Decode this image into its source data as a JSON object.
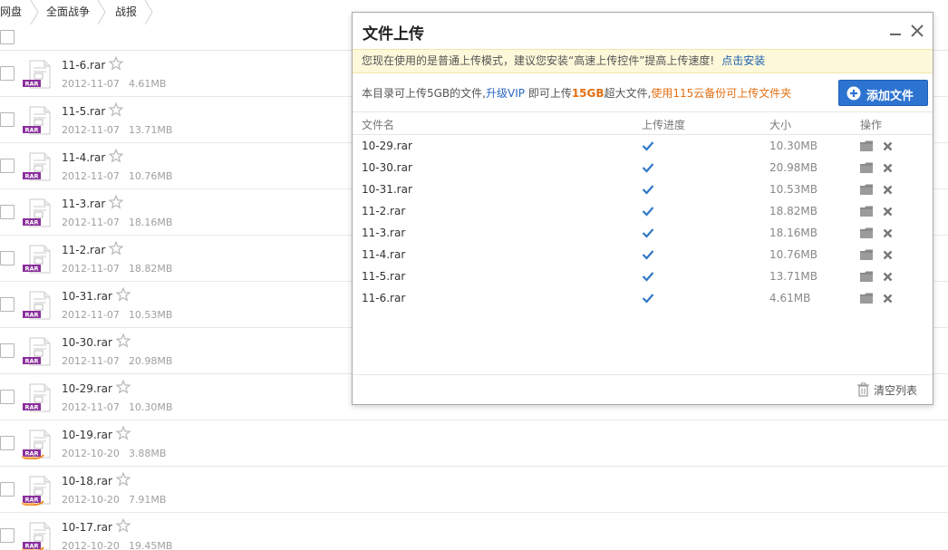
{
  "breadcrumb": {
    "items": [
      "网盘",
      "全面战争",
      "战报"
    ]
  },
  "files": [
    {
      "name": "11-6.rar",
      "date": "2012-11-07",
      "size": "4.61MB",
      "type": "rar-file-icon"
    },
    {
      "name": "11-5.rar",
      "date": "2012-11-07",
      "size": "13.71MB",
      "type": "rar-file-icon"
    },
    {
      "name": "11-4.rar",
      "date": "2012-11-07",
      "size": "10.76MB",
      "type": "rar-file-icon"
    },
    {
      "name": "11-3.rar",
      "date": "2012-11-07",
      "size": "18.16MB",
      "type": "rar-file-icon"
    },
    {
      "name": "11-2.rar",
      "date": "2012-11-07",
      "size": "18.82MB",
      "type": "rar-file-icon"
    },
    {
      "name": "10-31.rar",
      "date": "2012-11-07",
      "size": "10.53MB",
      "type": "rar-file-icon"
    },
    {
      "name": "10-30.rar",
      "date": "2012-11-07",
      "size": "20.98MB",
      "type": "rar-file-icon"
    },
    {
      "name": "10-29.rar",
      "date": "2012-11-07",
      "size": "10.30MB",
      "type": "rar-file-icon"
    },
    {
      "name": "10-19.rar",
      "date": "2012-10-20",
      "size": "3.88MB",
      "type": "shared-rar-file-icon"
    },
    {
      "name": "10-18.rar",
      "date": "2012-10-20",
      "size": "7.91MB",
      "type": "shared-rar-file-icon"
    },
    {
      "name": "10-17.rar",
      "date": "2012-10-20",
      "size": "19.45MB",
      "type": "shared-rar-file-icon"
    }
  ],
  "upload_dialog": {
    "title": "文件上传",
    "notice_text": "您现在使用的是普通上传模式，建议您安装“高速上传控件”提高上传速度!",
    "notice_link": "点击安装",
    "quota_prefix": "本目录可上传5GB的文件,",
    "quota_vip": "升级VIP",
    "quota_mid": "即可上传",
    "quota_big": "15GB",
    "quota_suffix": "超大文件,",
    "quota_backup": "使用115云备份可上传文件夹",
    "add_button": "添加文件",
    "columns": {
      "name": "文件名",
      "progress": "上传进度",
      "size": "大小",
      "action": "操作"
    },
    "uploads": [
      {
        "name": "10-29.rar",
        "size": "10.30MB",
        "status": "done"
      },
      {
        "name": "10-30.rar",
        "size": "20.98MB",
        "status": "done"
      },
      {
        "name": "10-31.rar",
        "size": "10.53MB",
        "status": "done"
      },
      {
        "name": "11-2.rar",
        "size": "18.82MB",
        "status": "done"
      },
      {
        "name": "11-3.rar",
        "size": "18.16MB",
        "status": "done"
      },
      {
        "name": "11-4.rar",
        "size": "10.76MB",
        "status": "done"
      },
      {
        "name": "11-5.rar",
        "size": "13.71MB",
        "status": "done"
      },
      {
        "name": "11-6.rar",
        "size": "4.61MB",
        "status": "done"
      }
    ],
    "clear_button": "清空列表"
  },
  "colors": {
    "accent_blue": "#2d74d1",
    "check_blue": "#2f78c8",
    "warning_orange": "#e36f12",
    "notice_bg": "#fdf8da",
    "rar_purple": "#8a2f9c"
  }
}
